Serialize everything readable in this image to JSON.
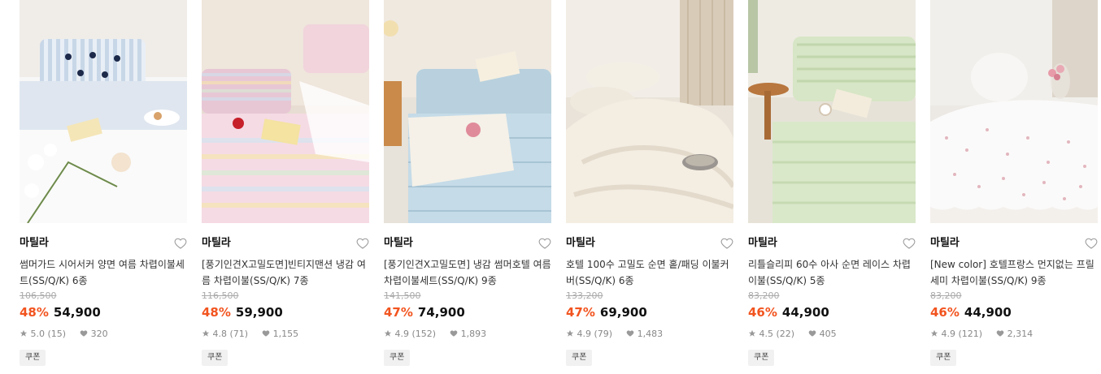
{
  "products": [
    {
      "brand": "마틸라",
      "title": "썸머가드 시어서커 양면 여름 차렵이불세트(SS/Q/K) 6종",
      "original_price": "106,500",
      "discount": "48%",
      "price": "54,900",
      "rating": "5.0",
      "review_count": "(15)",
      "likes": "320",
      "coupon": "쿠폰",
      "image": "bedding-blue-stripe-ribbon-photo"
    },
    {
      "brand": "마틸라",
      "title": "[풍기인견X고밀도면]빈티지맨션 냉감 여름 차렵이불(SS/Q/K) 7종",
      "original_price": "116,500",
      "discount": "48%",
      "price": "59,900",
      "rating": "4.8",
      "review_count": "(71)",
      "likes": "1,155",
      "coupon": "쿠폰",
      "image": "bedding-pastel-stripe-photo"
    },
    {
      "brand": "마틸라",
      "title": "[풍기인견X고밀도면] 냉감 썸머호텔 여름 차렵이불세트(SS/Q/K) 9종",
      "original_price": "141,500",
      "discount": "47%",
      "price": "74,900",
      "rating": "4.9",
      "review_count": "(152)",
      "likes": "1,893",
      "coupon": "쿠폰",
      "image": "bedding-sky-blue-quilt-photo"
    },
    {
      "brand": "마틸라",
      "title": "호텔 100수 고밀도 순면 홑/패딩 이불커버(SS/Q/K) 6종",
      "original_price": "133,200",
      "discount": "47%",
      "price": "69,900",
      "rating": "4.9",
      "review_count": "(79)",
      "likes": "1,483",
      "coupon": "쿠폰",
      "image": "bedding-ivory-duvet-photo"
    },
    {
      "brand": "마틸라",
      "title": "리틀슬리피 60수 아사 순면 레이스 차렵이불(SS/Q/K) 5종",
      "original_price": "83,200",
      "discount": "46%",
      "price": "44,900",
      "rating": "4.5",
      "review_count": "(22)",
      "likes": "405",
      "coupon": "쿠폰",
      "image": "bedding-mint-green-photo"
    },
    {
      "brand": "마틸라",
      "title": "[New color] 호텔프랑스 먼지없는 프릴 세미 차렵이불(SS/Q/K) 9종",
      "original_price": "83,200",
      "discount": "46%",
      "price": "44,900",
      "rating": "4.9",
      "review_count": "(121)",
      "likes": "2,314",
      "coupon": "쿠폰",
      "image": "bedding-white-floral-frill-photo"
    }
  ],
  "colors": {
    "discount": "#f2541f",
    "price": "#111111",
    "muted": "#888888"
  },
  "icons": {
    "wishlist": "heart-outline-icon",
    "rating": "star-icon",
    "likes": "heart-filled-icon"
  }
}
